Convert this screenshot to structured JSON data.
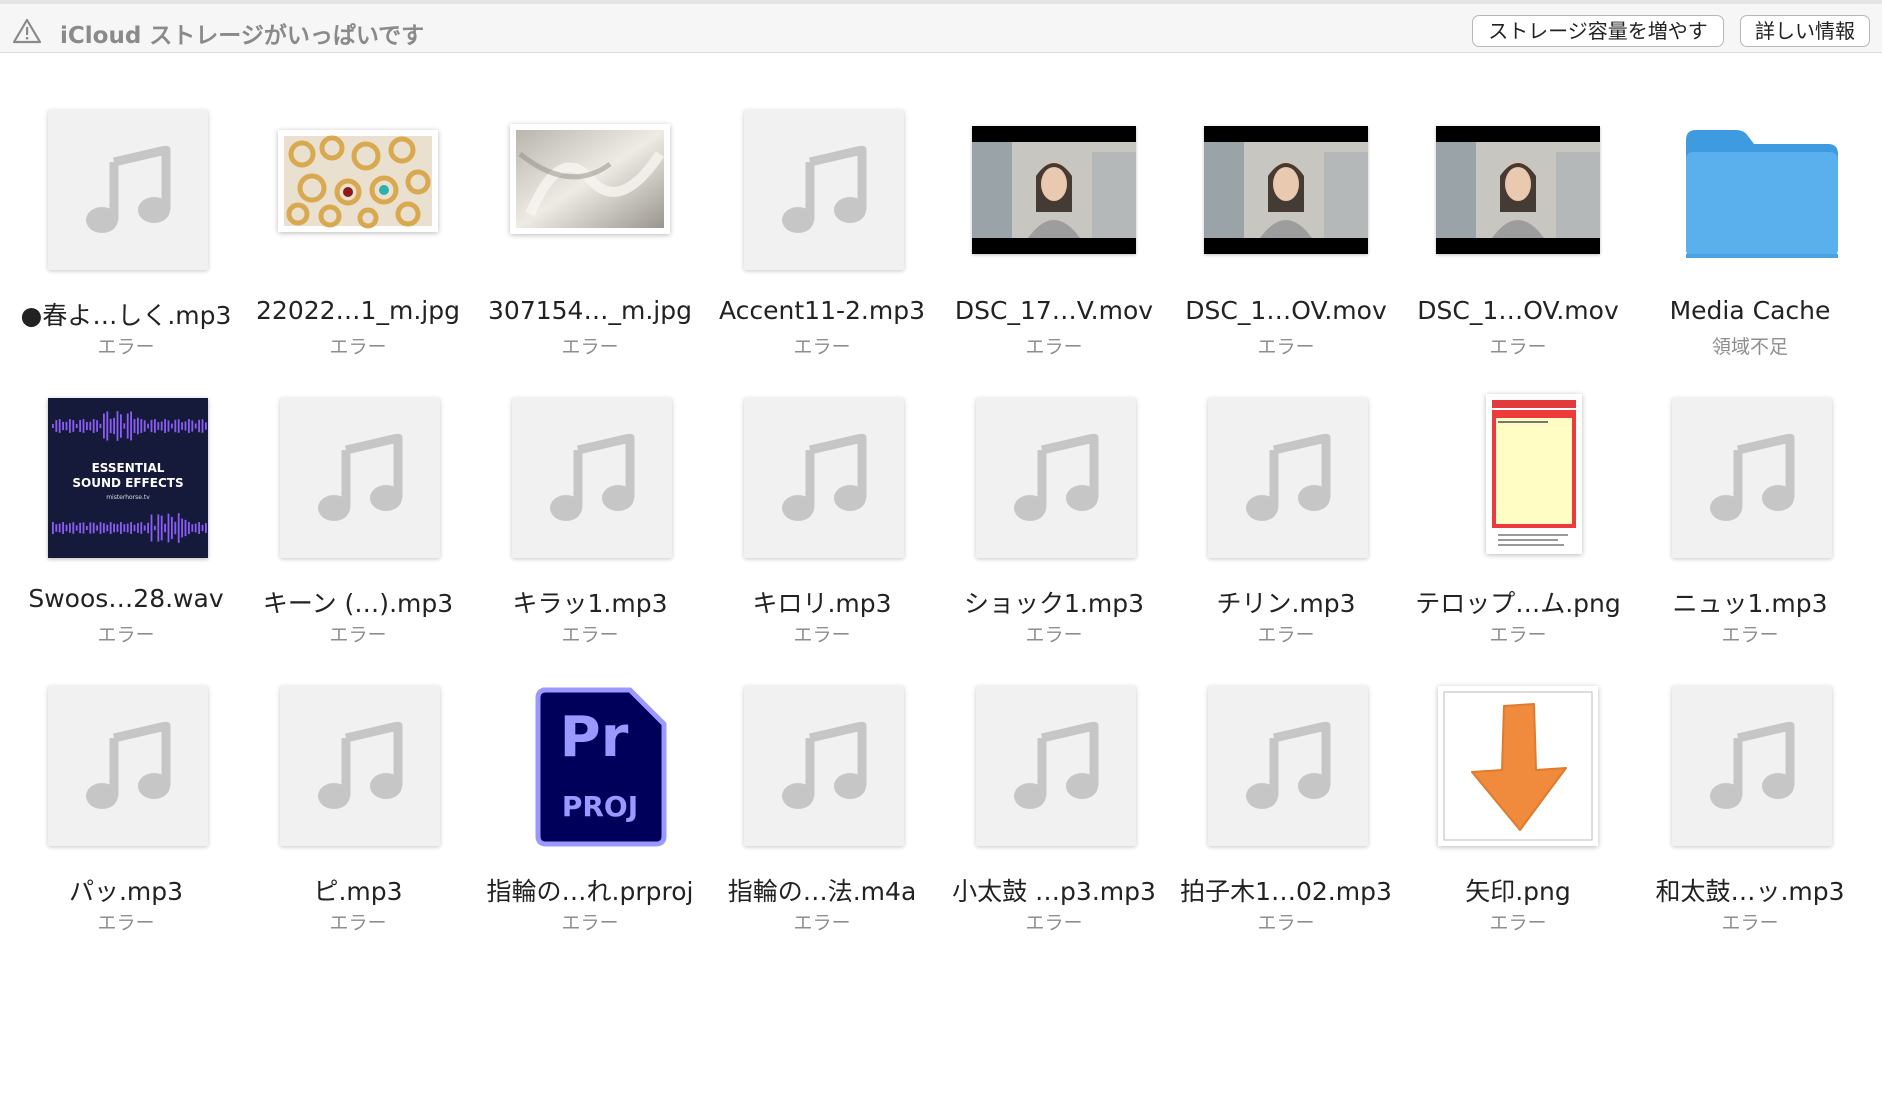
{
  "banner": {
    "title": "iCloud ストレージがいっぱいです",
    "buttons": {
      "storage": "ストレージ容量を増やす",
      "details": "詳しい情報"
    },
    "icon": "warning-triangle-icon"
  },
  "colors": {
    "folder": "#5ab0ec",
    "prproj_bg": "#00005b",
    "prproj_accent": "#9999ff",
    "arrow": "#f08a3c"
  },
  "files": [
    {
      "name": "●春よ…しく.mp3",
      "status": "エラー",
      "kind": "audio"
    },
    {
      "name": "22022…1_m.jpg",
      "status": "エラー",
      "kind": "photo-rings"
    },
    {
      "name": "307154…_m.jpg",
      "status": "エラー",
      "kind": "photo-silk"
    },
    {
      "name": "Accent11-2.mp3",
      "status": "エラー",
      "kind": "audio"
    },
    {
      "name": "DSC_17…V.mov",
      "status": "エラー",
      "kind": "video"
    },
    {
      "name": "DSC_1…OV.mov",
      "status": "エラー",
      "kind": "video"
    },
    {
      "name": "DSC_1…OV.mov",
      "status": "エラー",
      "kind": "video"
    },
    {
      "name": "Media Cache",
      "status": "領域不足",
      "kind": "folder"
    },
    {
      "name": "Swoos…28.wav",
      "status": "エラー",
      "kind": "sound-effects",
      "cover_lines": [
        "ESSENTIAL",
        "SOUND EFFECTS",
        "misterhorse.tv"
      ]
    },
    {
      "name": "キーン (…).mp3",
      "status": "エラー",
      "kind": "audio"
    },
    {
      "name": "キラッ1.mp3",
      "status": "エラー",
      "kind": "audio"
    },
    {
      "name": "キロリ.mp3",
      "status": "エラー",
      "kind": "audio"
    },
    {
      "name": "ショック1.mp3",
      "status": "エラー",
      "kind": "audio"
    },
    {
      "name": "チリン.mp3",
      "status": "エラー",
      "kind": "audio"
    },
    {
      "name": "テロップ…ム.png",
      "status": "エラー",
      "kind": "doc-png"
    },
    {
      "name": "ニュッ1.mp3",
      "status": "エラー",
      "kind": "audio"
    },
    {
      "name": "パッ.mp3",
      "status": "エラー",
      "kind": "audio"
    },
    {
      "name": "ピ.mp3",
      "status": "エラー",
      "kind": "audio"
    },
    {
      "name": "指輪の…れ.prproj",
      "status": "エラー",
      "kind": "prproj",
      "badge_lines": [
        "Pr",
        "PROJ"
      ]
    },
    {
      "name": "指輪の…法.m4a",
      "status": "エラー",
      "kind": "audio"
    },
    {
      "name": "小太鼓 …p3.mp3",
      "status": "エラー",
      "kind": "audio"
    },
    {
      "name": "拍子木1…02.mp3",
      "status": "エラー",
      "kind": "audio"
    },
    {
      "name": "矢印.png",
      "status": "エラー",
      "kind": "arrow-png"
    },
    {
      "name": "和太鼓…ッ.mp3",
      "status": "エラー",
      "kind": "audio"
    }
  ]
}
